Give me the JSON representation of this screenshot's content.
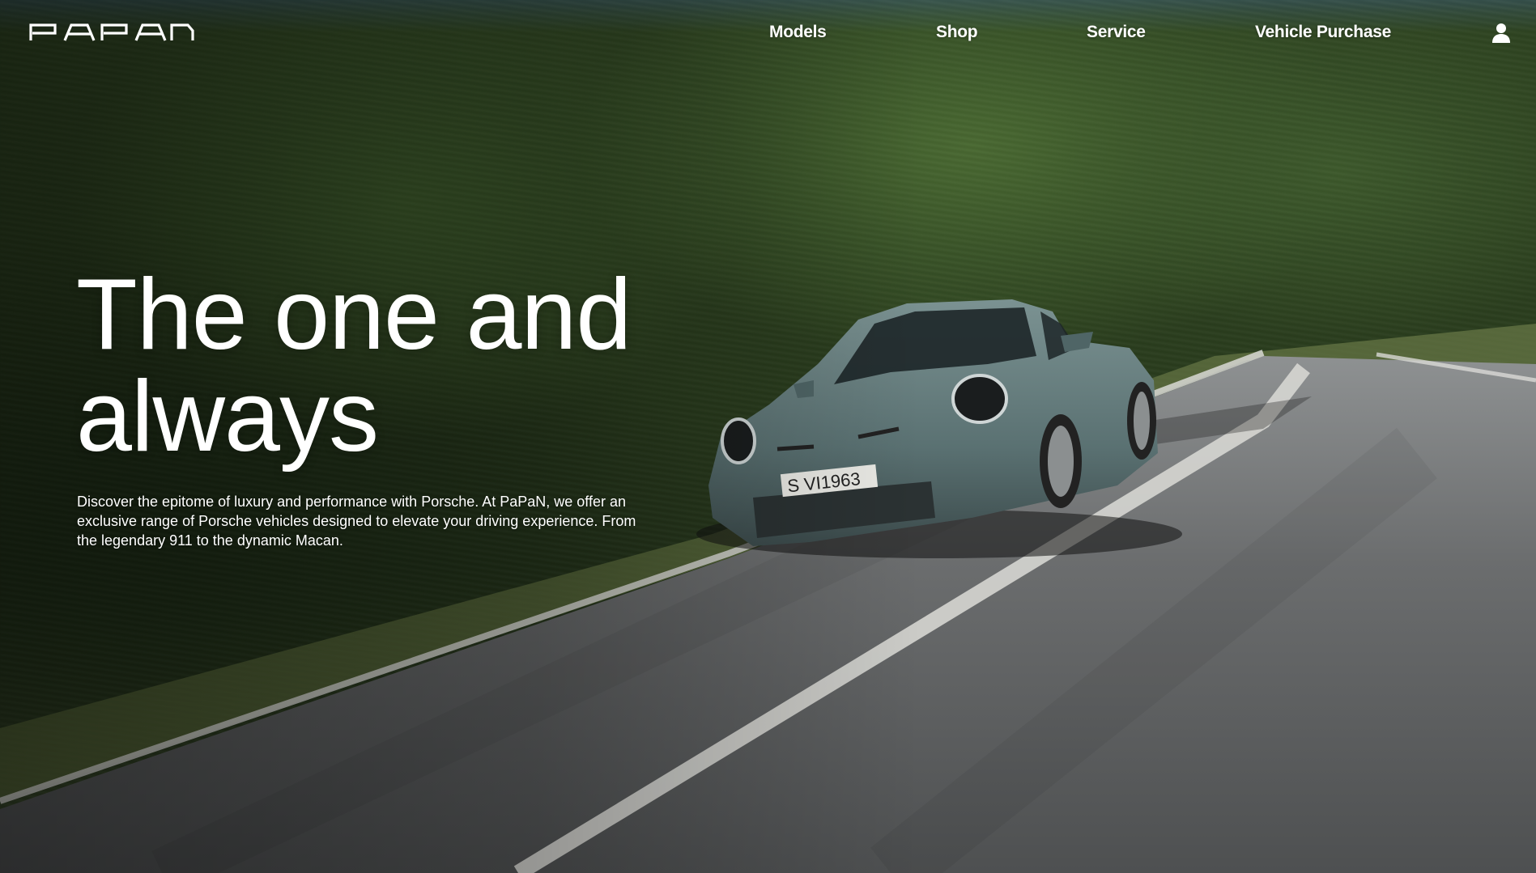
{
  "brand": {
    "logo_text": "PAPAN",
    "logo_icon": "papan-wordmark-logo"
  },
  "nav": {
    "items": [
      {
        "label": "Models"
      },
      {
        "label": "Shop"
      },
      {
        "label": "Service"
      },
      {
        "label": "Vehicle Purchase"
      }
    ],
    "account_icon": "user-icon"
  },
  "hero": {
    "title": "The one and always",
    "description": "Discover the epitome of luxury and performance with Porsche. At PaPaN, we offer an exclusive range of Porsche vehicles designed to elevate your driving experience. From the legendary 911 to the dynamic Macan.",
    "background_image": "porsche-911-on-mountain-road",
    "license_plate": "S VI 1963"
  },
  "colors": {
    "text": "#ffffff",
    "foliage": "#2f4522",
    "road": "#5a5c5e",
    "car": "#5d7575"
  }
}
